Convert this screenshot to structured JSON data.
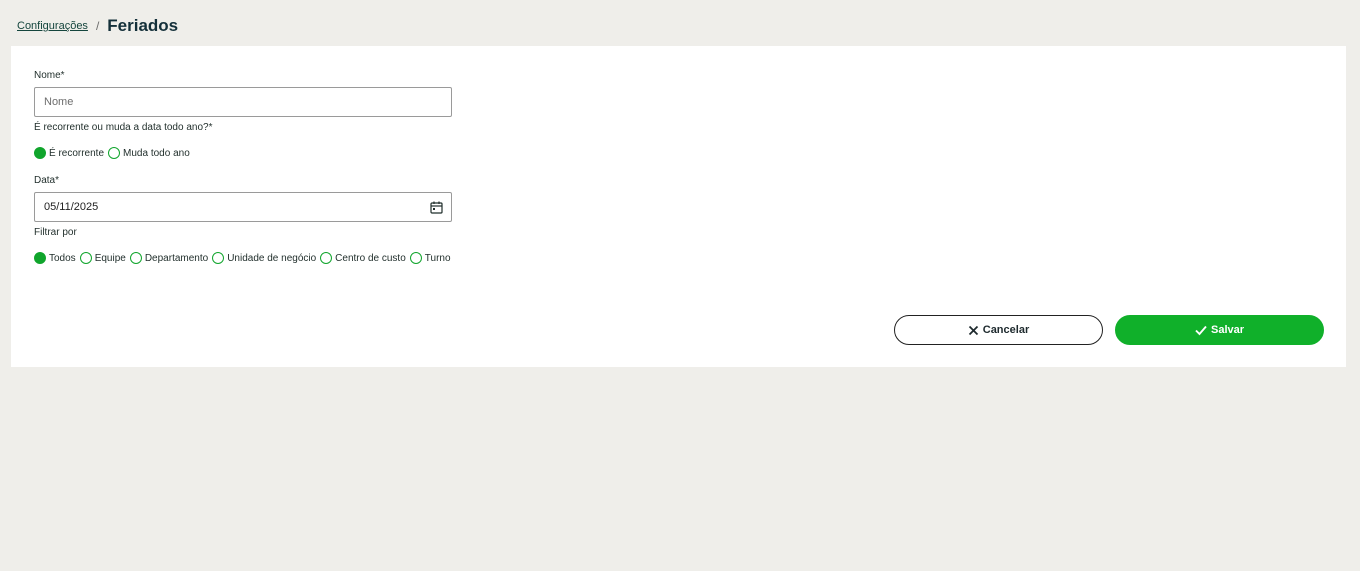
{
  "breadcrumb": {
    "parent": "Configurações",
    "separator": "/",
    "current": "Feriados"
  },
  "form": {
    "nome": {
      "label": "Nome*",
      "placeholder": "Nome",
      "value": ""
    },
    "recorrencia": {
      "label": "É recorrente ou muda a data todo ano?*",
      "options": [
        {
          "label": "É recorrente",
          "checked": true
        },
        {
          "label": "Muda todo ano",
          "checked": false
        }
      ]
    },
    "data": {
      "label": "Data*",
      "value": "05/11/2025",
      "icon": "calendar-icon"
    },
    "filtro": {
      "label": "Filtrar por",
      "options": [
        {
          "label": "Todos",
          "checked": true
        },
        {
          "label": "Equipe",
          "checked": false
        },
        {
          "label": "Departamento",
          "checked": false
        },
        {
          "label": "Unidade de negócio",
          "checked": false
        },
        {
          "label": "Centro de custo",
          "checked": false
        },
        {
          "label": "Turno",
          "checked": false
        }
      ]
    }
  },
  "actions": {
    "cancel_label": "Cancelar",
    "cancel_icon": "close-icon",
    "save_label": "Salvar",
    "save_icon": "check-icon"
  },
  "colors": {
    "accent": "#10b02a",
    "background": "#efeeea",
    "title": "#14303a"
  }
}
